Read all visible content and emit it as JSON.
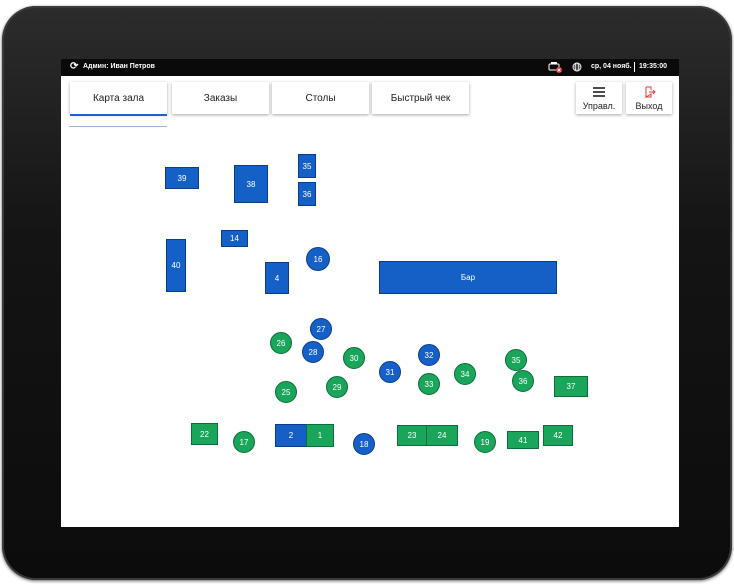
{
  "status": {
    "user": "Админ: Иван Петров",
    "date": "ср, 04 нояб.",
    "time": "19:35:00"
  },
  "tabs": [
    {
      "label": "Карта зала",
      "active": true
    },
    {
      "label": "Заказы",
      "active": false
    },
    {
      "label": "Столы",
      "active": false
    },
    {
      "label": "Быстрый чек",
      "active": false
    }
  ],
  "actions": {
    "manage_label": "Управл.",
    "exit_label": "Выход"
  },
  "colors": {
    "free": "#19a55a",
    "occupied": "#1560c7",
    "exit_icon": "#e53935"
  },
  "tables": [
    {
      "label": "39",
      "shape": "rect",
      "status": "occupied"
    },
    {
      "label": "38",
      "shape": "rect",
      "status": "occupied"
    },
    {
      "label": "35",
      "shape": "rect",
      "status": "occupied"
    },
    {
      "label": "36",
      "shape": "rect",
      "status": "occupied"
    },
    {
      "label": "14",
      "shape": "rect",
      "status": "occupied"
    },
    {
      "label": "40",
      "shape": "rect",
      "status": "occupied"
    },
    {
      "label": "4",
      "shape": "rect",
      "status": "occupied"
    },
    {
      "label": "16",
      "shape": "round",
      "status": "occupied"
    },
    {
      "label": "Бар",
      "shape": "rect",
      "status": "occupied"
    },
    {
      "label": "27",
      "shape": "round",
      "status": "occupied"
    },
    {
      "label": "26",
      "shape": "round",
      "status": "free"
    },
    {
      "label": "28",
      "shape": "round",
      "status": "occupied"
    },
    {
      "label": "30",
      "shape": "round",
      "status": "free"
    },
    {
      "label": "32",
      "shape": "round",
      "status": "occupied"
    },
    {
      "label": "35",
      "shape": "round",
      "status": "free"
    },
    {
      "label": "31",
      "shape": "round",
      "status": "occupied"
    },
    {
      "label": "34",
      "shape": "round",
      "status": "free"
    },
    {
      "label": "36",
      "shape": "round",
      "status": "free"
    },
    {
      "label": "37",
      "shape": "rect",
      "status": "free"
    },
    {
      "label": "29",
      "shape": "round",
      "status": "free"
    },
    {
      "label": "33",
      "shape": "round",
      "status": "free"
    },
    {
      "label": "25",
      "shape": "round",
      "status": "free"
    },
    {
      "label": "22",
      "shape": "rect",
      "status": "free"
    },
    {
      "label": "17",
      "shape": "round",
      "status": "free"
    },
    {
      "label": "2",
      "shape": "rect",
      "status": "occupied"
    },
    {
      "label": "1",
      "shape": "rect",
      "status": "free"
    },
    {
      "label": "18",
      "shape": "round",
      "status": "occupied"
    },
    {
      "label": "23",
      "shape": "rect",
      "status": "free"
    },
    {
      "label": "24",
      "shape": "rect",
      "status": "free"
    },
    {
      "label": "19",
      "shape": "round",
      "status": "free"
    },
    {
      "label": "41",
      "shape": "rect",
      "status": "free"
    },
    {
      "label": "42",
      "shape": "rect",
      "status": "free"
    }
  ]
}
